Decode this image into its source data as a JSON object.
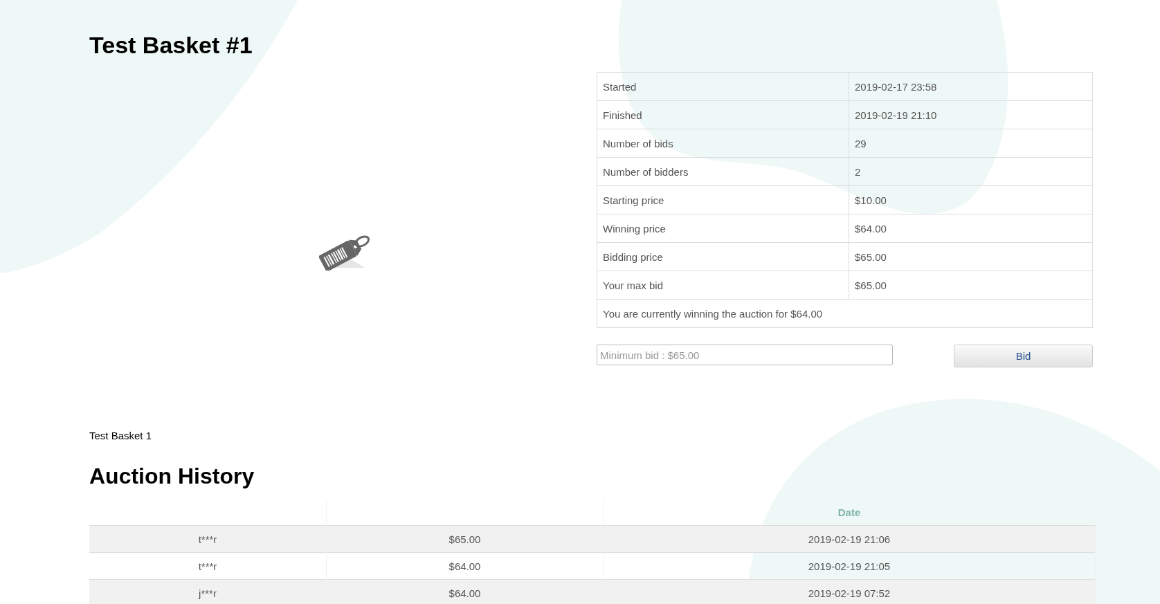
{
  "title": "Test Basket #1",
  "details": [
    {
      "label": "Started",
      "value": "2019-02-17 23:58"
    },
    {
      "label": "Finished",
      "value": "2019-02-19 21:10"
    },
    {
      "label": "Number of bids",
      "value": "29"
    },
    {
      "label": "Number of bidders",
      "value": "2"
    },
    {
      "label": "Starting price",
      "value": "$10.00"
    },
    {
      "label": "Winning price",
      "value": "$64.00"
    },
    {
      "label": "Bidding price",
      "value": "$65.00"
    },
    {
      "label": "Your max bid",
      "value": "$65.00"
    }
  ],
  "status_message": "You are currently winning the auction for $64.00",
  "bid_field": {
    "placeholder": "Minimum bid : $65.00"
  },
  "bid_button": "Bid",
  "description": "Test Basket 1",
  "history": {
    "title": "Auction History",
    "date_header": "Date",
    "rows": [
      [
        "t***r",
        "$65.00",
        "2019-02-19 21:06"
      ],
      [
        "t***r",
        "$64.00",
        "2019-02-19 21:05"
      ],
      [
        "j***r",
        "$64.00",
        "2019-02-19 07:52"
      ]
    ]
  }
}
